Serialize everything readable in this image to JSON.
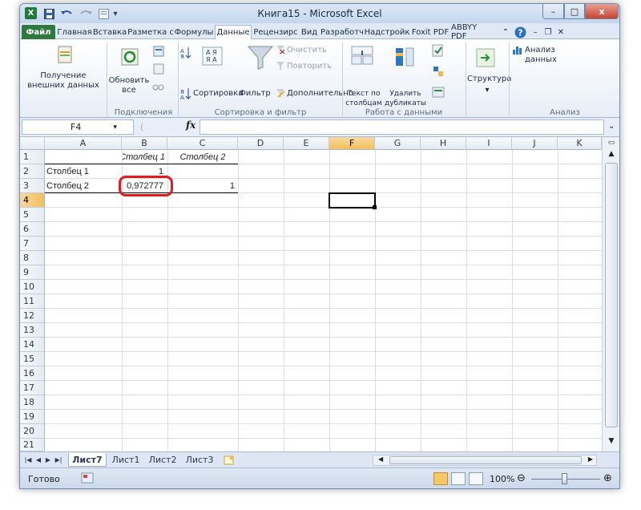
{
  "window": {
    "title": "Книга15 - Microsoft Excel"
  },
  "quick_access": {
    "logo": "X",
    "save_icon": "save-icon",
    "undo_icon": "undo-icon",
    "redo_icon": "redo-icon"
  },
  "window_buttons": {
    "minimize": "–",
    "maximize": "□",
    "close": "x"
  },
  "tabs": [
    "Файл",
    "Главная",
    "Вставка",
    "Разметка с",
    "Формулы",
    "Данные",
    "Рецензирс",
    "Вид",
    "Разработч",
    "Надстройк",
    "Foxit PDF",
    "ABBYY PDF"
  ],
  "active_tab": "Данные",
  "ribbon": {
    "ext_data": "Получение внешних данных",
    "refresh_all": "Обновить все",
    "conn_group": "Подключения",
    "sort": "Сортировка",
    "filter": "Фильтр",
    "clear": "Очистить",
    "reapply": "Повторить",
    "advanced": "Дополнительно",
    "sort_group": "Сортировка и фильтр",
    "text_to_cols": "Текст по столбцам",
    "remove_dupes": "Удалить дубликаты",
    "data_tools_group": "Работа с данными",
    "outline": "Структура",
    "data_analysis": "Анализ данных",
    "analysis_group": "Анализ"
  },
  "formula_bar": {
    "name_box": "F4",
    "fx": "fx",
    "value": ""
  },
  "columns": [
    "A",
    "B",
    "C",
    "D",
    "E",
    "F",
    "G",
    "H",
    "I",
    "J",
    "K"
  ],
  "active_column": "F",
  "rows": [
    "1",
    "2",
    "3",
    "4",
    "5",
    "6",
    "7",
    "8",
    "9",
    "10",
    "11",
    "12",
    "13",
    "14",
    "15",
    "16",
    "17",
    "18",
    "19",
    "20",
    "21"
  ],
  "active_row": "4",
  "cells": {
    "B1": "Столбец 1",
    "C1": "Столбец 2",
    "A2": "Столбец 1",
    "B2": "1",
    "A3": "Столбец 2",
    "B3": "0,972777",
    "C3": "1"
  },
  "sheets": [
    "Лист7",
    "Лист1",
    "Лист2",
    "Лист3"
  ],
  "active_sheet": "Лист7",
  "status": {
    "ready": "Готово",
    "zoom": "100%"
  },
  "colors": {
    "highlight": "#e21b1b",
    "accent": "#2c7a3f"
  }
}
